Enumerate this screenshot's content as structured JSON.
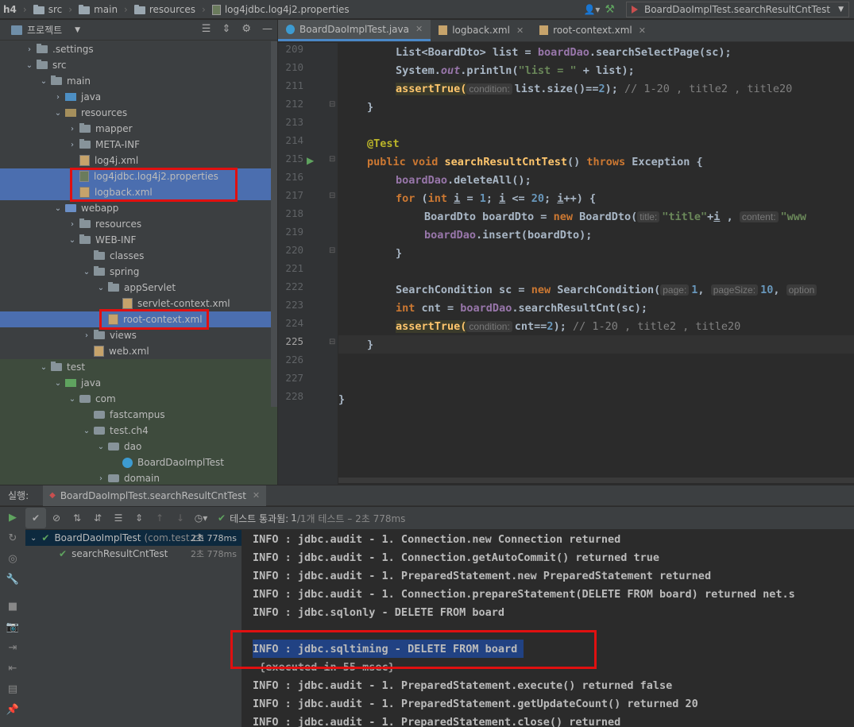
{
  "navbar": {
    "crumbs": [
      "h4",
      "src",
      "main",
      "resources",
      "log4jdbc.log4j2.properties"
    ],
    "run_config": "BoardDaoImplTest.searchResultCntTest"
  },
  "project": {
    "title": "프로젝트",
    "tree": [
      {
        "label": ".settings",
        "indent": 1,
        "arrow": "›",
        "icon": "folder"
      },
      {
        "label": "src",
        "indent": 1,
        "arrow": "⌄",
        "icon": "folder"
      },
      {
        "label": "main",
        "indent": 2,
        "arrow": "⌄",
        "icon": "folder"
      },
      {
        "label": "java",
        "indent": 3,
        "arrow": "›",
        "icon": "java"
      },
      {
        "label": "resources",
        "indent": 3,
        "arrow": "⌄",
        "icon": "res"
      },
      {
        "label": "mapper",
        "indent": 4,
        "arrow": "›",
        "icon": "folder"
      },
      {
        "label": "META-INF",
        "indent": 4,
        "arrow": "›",
        "icon": "folder"
      },
      {
        "label": "log4j.xml",
        "indent": 4,
        "arrow": "",
        "icon": "xml"
      },
      {
        "label": "log4jdbc.log4j2.properties",
        "indent": 4,
        "arrow": "",
        "icon": "props",
        "selected": true
      },
      {
        "label": "logback.xml",
        "indent": 4,
        "arrow": "",
        "icon": "xml",
        "selected": true
      },
      {
        "label": "webapp",
        "indent": 3,
        "arrow": "⌄",
        "icon": "web"
      },
      {
        "label": "resources",
        "indent": 4,
        "arrow": "›",
        "icon": "folder"
      },
      {
        "label": "WEB-INF",
        "indent": 4,
        "arrow": "⌄",
        "icon": "folder"
      },
      {
        "label": "classes",
        "indent": 5,
        "arrow": "",
        "icon": "folder"
      },
      {
        "label": "spring",
        "indent": 5,
        "arrow": "⌄",
        "icon": "folder"
      },
      {
        "label": "appServlet",
        "indent": 6,
        "arrow": "⌄",
        "icon": "folder"
      },
      {
        "label": "servlet-context.xml",
        "indent": 7,
        "arrow": "",
        "icon": "xml"
      },
      {
        "label": "root-context.xml",
        "indent": 6,
        "arrow": "",
        "icon": "xml",
        "selected": true
      },
      {
        "label": "views",
        "indent": 5,
        "arrow": "›",
        "icon": "folder"
      },
      {
        "label": "web.xml",
        "indent": 5,
        "arrow": "",
        "icon": "xml"
      },
      {
        "label": "test",
        "indent": 2,
        "arrow": "⌄",
        "icon": "folder",
        "green": true
      },
      {
        "label": "java",
        "indent": 3,
        "arrow": "⌄",
        "icon": "testjava",
        "green": true
      },
      {
        "label": "com",
        "indent": 4,
        "arrow": "⌄",
        "icon": "pkg",
        "green": true
      },
      {
        "label": "fastcampus",
        "indent": 5,
        "arrow": "",
        "icon": "pkg",
        "green": true
      },
      {
        "label": "test.ch4",
        "indent": 5,
        "arrow": "⌄",
        "icon": "pkg",
        "green": true
      },
      {
        "label": "dao",
        "indent": 6,
        "arrow": "⌄",
        "icon": "pkg",
        "green": true
      },
      {
        "label": "BoardDaoImplTest",
        "indent": 7,
        "arrow": "",
        "icon": "class",
        "green": true
      },
      {
        "label": "domain",
        "indent": 6,
        "arrow": "›",
        "icon": "pkg",
        "green": true
      }
    ]
  },
  "editor": {
    "tabs": [
      {
        "label": "BoardDaoImplTest.java",
        "active": true,
        "icon": "#3d9bd1"
      },
      {
        "label": "logback.xml",
        "active": false,
        "icon": "#c6a36b"
      },
      {
        "label": "root-context.xml",
        "active": false,
        "icon": "#c6a36b"
      }
    ],
    "line_numbers": [
      "209",
      "210",
      "211",
      "212",
      "213",
      "214",
      "215",
      "216",
      "217",
      "218",
      "219",
      "220",
      "221",
      "222",
      "223",
      "224",
      "225",
      "226",
      "227",
      "228"
    ],
    "code": {
      "l209a": "List<BoardDto> list = ",
      "l209b": "boardDao",
      "l209c": ".searchSelectPage(sc);",
      "l210a": "System.",
      "l210b": "out",
      "l210c": ".println(",
      "l210d": "\"list = \"",
      "l210e": " + list);",
      "l211a": "assertTrue(",
      "l211h": "condition:",
      "l211b": "list.size()==",
      "l211n": "2",
      "l211c": "); ",
      "l211d": "// 1-20 , title2 , title20",
      "l212": "}",
      "l214": "@Test",
      "l215a": "public void ",
      "l215b": "searchResultCntTest",
      "l215c": "() ",
      "l215d": "throws ",
      "l215e": "Exception {",
      "l216a": "boardDao",
      "l216b": ".deleteAll();",
      "l217a": "for ",
      "l217b": "(",
      "l217c": "int ",
      "l217d": "i",
      "l217e": " = ",
      "l217f": "1",
      "l217g": "; ",
      "l217h": "i",
      "l217i": " <= ",
      "l217j": "20",
      "l217k": "; ",
      "l217l": "i",
      "l217m": "++) {",
      "l218a": "BoardDto boardDto = ",
      "l218b": "new ",
      "l218c": "BoardDto(",
      "l218h1": "title:",
      "l218d": "\"title\"",
      "l218e": "+",
      "l218f": "i",
      "l218g": " , ",
      "l218h2": "content:",
      "l218i": "\"www",
      "l219a": "boardDao",
      "l219b": ".insert(boardDto);",
      "l220": "}",
      "l222a": "SearchCondition sc = ",
      "l222b": "new ",
      "l222c": "SearchCondition(",
      "l222h1": "page:",
      "l222d": "1",
      "l222e": ", ",
      "l222h2": "pageSize:",
      "l222f": "10",
      "l222g": ", ",
      "l222h3": "option",
      "l223a": "int ",
      "l223b": "cnt = ",
      "l223c": "boardDao",
      "l223d": ".searchResultCnt(sc);",
      "l224a": "assertTrue(",
      "l224h": "condition:",
      "l224b": "cnt==",
      "l224n": "2",
      "l224c": "); ",
      "l224d": "// 1-20 , title2 , title20",
      "l225": "}",
      "l228": "}"
    }
  },
  "run": {
    "label": "실행:",
    "tab": "BoardDaoImplTest.searchResultCntTest",
    "status_prefix": "테스트 통과됨: ",
    "status_count": "1",
    "status_suffix": "/1개 테스트 – 2초 778ms",
    "tests": [
      {
        "label": "BoardDaoImplTest",
        "detail": "(com.test.ch",
        "time": "2초 778ms"
      },
      {
        "label": "searchResultCntTest",
        "detail": "",
        "time": "2초 778ms"
      }
    ],
    "console": [
      "INFO : jdbc.audit - 1. Connection.new Connection returned",
      "INFO : jdbc.audit - 1. Connection.getAutoCommit() returned true",
      "INFO : jdbc.audit - 1. PreparedStatement.new PreparedStatement returned",
      "INFO : jdbc.audit - 1. Connection.prepareStatement(DELETE FROM board) returned net.s",
      "INFO : jdbc.sqlonly - DELETE FROM board",
      "",
      "INFO : jdbc.sqltiming - DELETE FROM board ",
      " {executed in 55 msec}",
      "INFO : jdbc.audit - 1. PreparedStatement.execute() returned false",
      "INFO : jdbc.audit - 1. PreparedStatement.getUpdateCount() returned 20",
      "INFO : jdbc.audit - 1. PreparedStatement.close() returned"
    ]
  }
}
